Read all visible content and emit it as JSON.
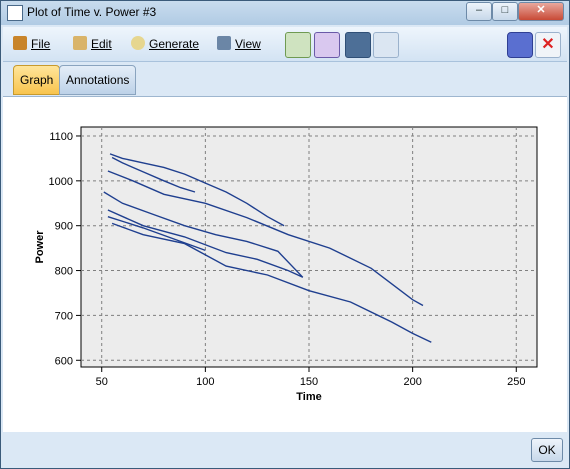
{
  "window": {
    "title": "Plot of Time v. Power #3",
    "close_label": "✕",
    "min_label": "–",
    "max_label": "□"
  },
  "menu": {
    "file": "File",
    "edit": "Edit",
    "generate": "Generate",
    "view": "View"
  },
  "tabs": [
    {
      "label": "Graph"
    },
    {
      "label": "Annotations"
    }
  ],
  "footer": {
    "ok_label": "OK"
  },
  "chart_data": {
    "type": "line",
    "xlabel": "Time",
    "ylabel": "Power",
    "xlim": [
      40,
      260
    ],
    "ylim": [
      585,
      1120
    ],
    "xticks": [
      50,
      100,
      150,
      200,
      250
    ],
    "yticks": [
      600,
      700,
      800,
      900,
      1000,
      1100
    ],
    "grid": true,
    "series": [
      {
        "values": [
          [
            54,
            1060
          ],
          [
            60,
            1050
          ],
          [
            70,
            1040
          ],
          [
            80,
            1030
          ],
          [
            90,
            1015
          ],
          [
            100,
            995
          ],
          [
            110,
            975
          ],
          [
            120,
            950
          ],
          [
            130,
            920
          ],
          [
            138,
            900
          ]
        ]
      },
      {
        "values": [
          [
            55,
            1052
          ],
          [
            60,
            1040
          ],
          [
            70,
            1020
          ],
          [
            80,
            1000
          ],
          [
            88,
            985
          ],
          [
            95,
            975
          ]
        ]
      },
      {
        "values": [
          [
            53,
            1022
          ],
          [
            65,
            1000
          ],
          [
            80,
            970
          ],
          [
            100,
            950
          ],
          [
            120,
            918
          ],
          [
            140,
            880
          ],
          [
            160,
            850
          ],
          [
            180,
            805
          ],
          [
            200,
            735
          ],
          [
            205,
            722
          ]
        ]
      },
      {
        "values": [
          [
            51,
            975
          ],
          [
            60,
            950
          ],
          [
            75,
            925
          ],
          [
            90,
            900
          ],
          [
            105,
            880
          ],
          [
            120,
            865
          ],
          [
            135,
            843
          ],
          [
            147,
            785
          ]
        ]
      },
      {
        "values": [
          [
            53,
            935
          ],
          [
            70,
            900
          ],
          [
            90,
            875
          ],
          [
            110,
            840
          ],
          [
            125,
            825
          ],
          [
            140,
            800
          ],
          [
            147,
            785
          ]
        ]
      },
      {
        "values": [
          [
            53,
            920
          ],
          [
            70,
            895
          ],
          [
            85,
            870
          ],
          [
            100,
            845
          ]
        ]
      },
      {
        "values": [
          [
            55,
            905
          ],
          [
            70,
            880
          ],
          [
            90,
            860
          ],
          [
            110,
            810
          ],
          [
            130,
            790
          ],
          [
            150,
            755
          ],
          [
            170,
            730
          ],
          [
            190,
            685
          ],
          [
            200,
            660
          ],
          [
            209,
            640
          ]
        ]
      }
    ]
  }
}
